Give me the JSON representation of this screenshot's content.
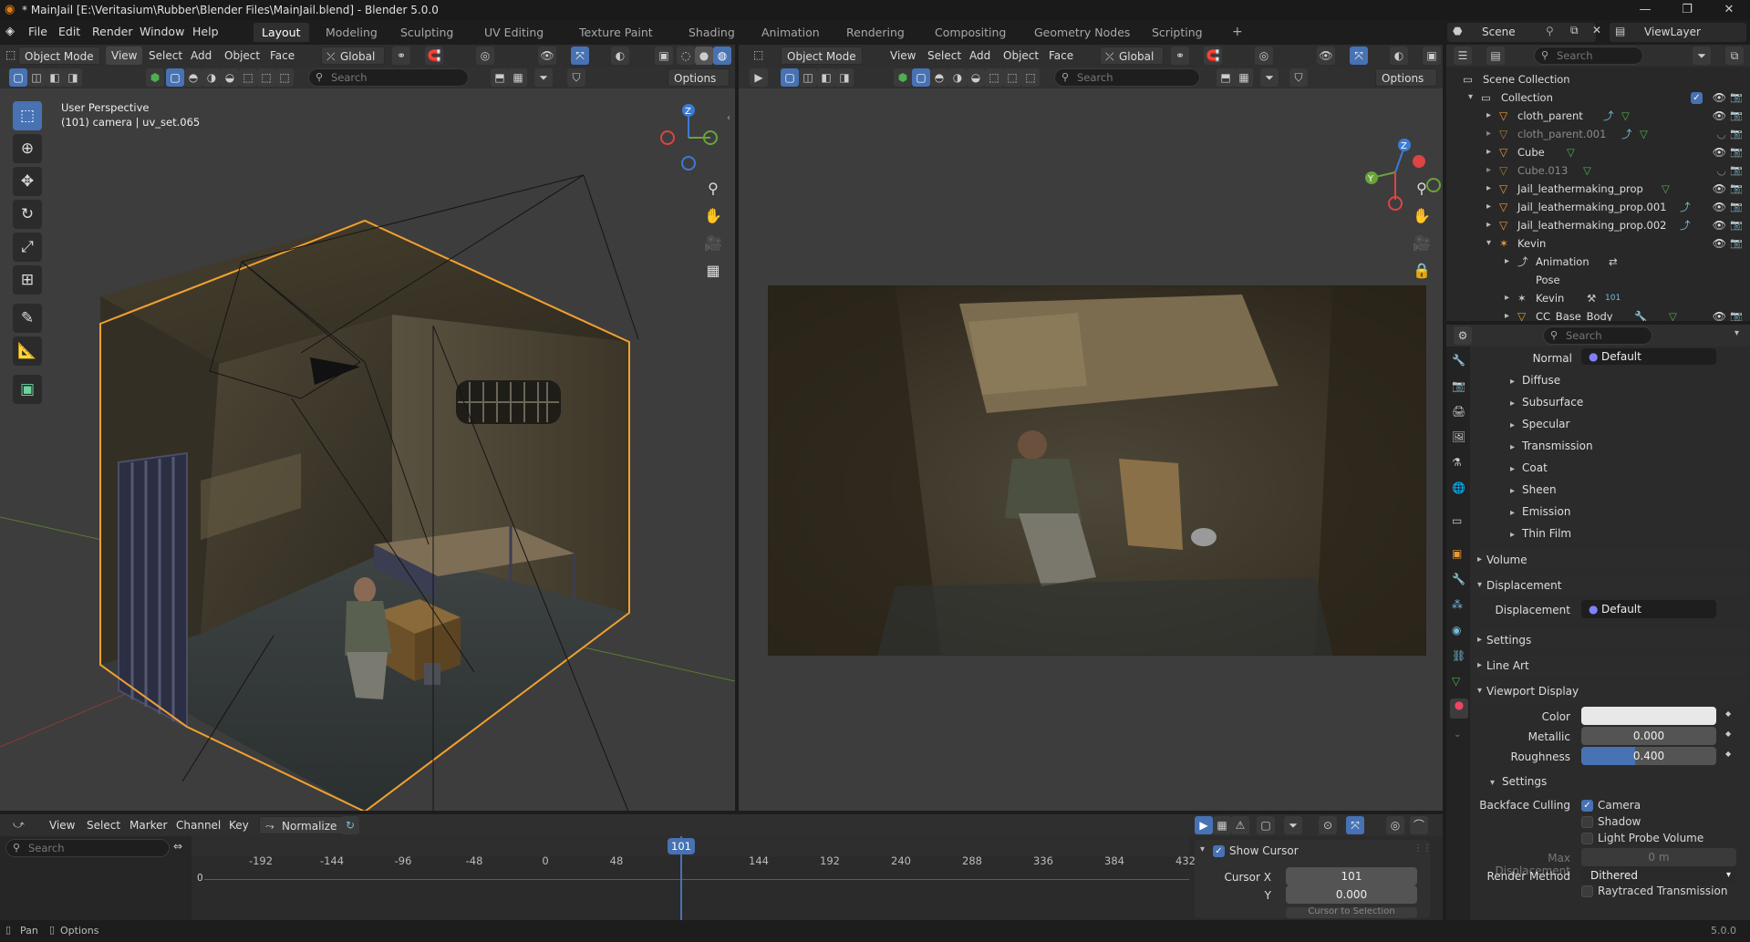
{
  "window": {
    "title": "* MainJail [E:\\Veritasium\\Rubber\\Blender Files\\MainJail.blend] - Blender 5.0.0"
  },
  "menu": [
    "File",
    "Edit",
    "Render",
    "Window",
    "Help"
  ],
  "workspaces": [
    "Layout",
    "Modeling",
    "Sculpting",
    "UV Editing",
    "Texture Paint",
    "Shading",
    "Animation",
    "Rendering",
    "Compositing",
    "Geometry Nodes",
    "Scripting"
  ],
  "active_workspace": "Layout",
  "scene": {
    "name": "Scene",
    "view_layer": "ViewLayer"
  },
  "viewport_left": {
    "mode": "Object Mode",
    "menus": [
      "View",
      "Select",
      "Add",
      "Object",
      "Face"
    ],
    "orientation": "Global",
    "search_placeholder": "Search",
    "options": "Options",
    "overlay_line1": "User Perspective",
    "overlay_line2": "(101) camera | uv_set.065"
  },
  "viewport_right": {
    "mode": "Object Mode",
    "menus": [
      "View",
      "Select",
      "Add",
      "Object",
      "Face"
    ],
    "orientation": "Global",
    "search_placeholder": "Search",
    "options": "Options"
  },
  "outliner": {
    "search_placeholder": "Search",
    "scene_collection": "Scene Collection",
    "collection": "Collection",
    "items": [
      {
        "label": "cloth_parent",
        "dim": false
      },
      {
        "label": "cloth_parent.001",
        "dim": true
      },
      {
        "label": "Cube",
        "dim": false
      },
      {
        "label": "Cube.013",
        "dim": true
      },
      {
        "label": "Jail_leathermaking_prop",
        "dim": false
      },
      {
        "label": "Jail_leathermaking_prop.001",
        "dim": false
      },
      {
        "label": "Jail_leathermaking_prop.002",
        "dim": false
      },
      {
        "label": "Kevin",
        "dim": false
      }
    ],
    "kevin_children": [
      {
        "label": "Animation"
      },
      {
        "label": "Pose"
      },
      {
        "label": "Kevin",
        "badge": "101"
      },
      {
        "label": "CC_Base_Body"
      }
    ]
  },
  "properties": {
    "search_placeholder": "Search",
    "normal_label": "Normal",
    "normal_value": "Default",
    "subpanels": [
      "Diffuse",
      "Subsurface",
      "Specular",
      "Transmission",
      "Coat",
      "Sheen",
      "Emission",
      "Thin Film"
    ],
    "volume": "Volume",
    "displacement": "Displacement",
    "displacement_label": "Displacement",
    "displacement_value": "Default",
    "settings": "Settings",
    "line_art": "Line Art",
    "viewport_display": "Viewport Display",
    "color_label": "Color",
    "metallic_label": "Metallic",
    "metallic_value": "0.000",
    "roughness_label": "Roughness",
    "roughness_value": "0.400",
    "roughness_fraction": 0.4,
    "settings_sub": "Settings",
    "backface_label": "Backface Culling",
    "camera_label": "Camera",
    "shadow_label": "Shadow",
    "light_probe_label": "Light Probe Volume",
    "max_disp_label": "Max Displacement",
    "max_disp_value": "0 m",
    "render_method_label": "Render Method",
    "render_method_value": "Dithered",
    "raytraced_label": "Raytraced Transmission"
  },
  "graph_editor": {
    "menus": [
      "View",
      "Select",
      "Marker",
      "Channel",
      "Key"
    ],
    "normalize": "Normalize",
    "search_placeholder": "Search",
    "ticks": [
      "-192",
      "-144",
      "-96",
      "-48",
      "0",
      "48",
      "101",
      "144",
      "192",
      "240",
      "288",
      "336",
      "384",
      "432"
    ],
    "current_frame": "101",
    "zero_label": "0",
    "show_cursor": "Show Cursor",
    "cursor_x_label": "Cursor X",
    "cursor_x_value": "101",
    "cursor_y_label": "Y",
    "cursor_y_value": "0.000",
    "cursor_to_selection": "Cursor to Selection"
  },
  "statusbar": {
    "pan": "Pan",
    "options": "Options",
    "version": "5.0.0"
  },
  "colors": {
    "accent": "#4772b3",
    "selection_outline": "#f0a030",
    "bg": "#1d1d1d",
    "header": "#2f2f2f"
  }
}
